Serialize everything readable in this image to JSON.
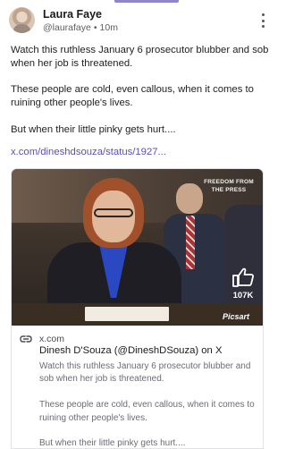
{
  "post": {
    "author_name": "Laura Faye",
    "handle": "@laurafaye",
    "separator": "•",
    "time": "10m",
    "paragraphs": [
      "Watch this ruthless January 6 prosecutor blubber and sob when her job is threatened.",
      "These people are cold, even callous, when it comes to ruining other people's lives.",
      "But when their little pinky gets hurt...."
    ],
    "link_text": "x.com/dineshdsouza/status/1927..."
  },
  "card": {
    "video": {
      "watermark": "FREEDOM FROM THE PRESS",
      "likes": "107K",
      "app_watermark": "Picsart"
    },
    "domain": "x.com",
    "title": "Dinesh D'Souza (@DineshDSouza) on X",
    "description": [
      "Watch this ruthless January 6 prosecutor blubber and sob when her job is threatened.",
      "These people are cold, even callous, when it comes to ruining other people's lives.",
      "But when their little pinky gets hurt...."
    ]
  },
  "icons": {
    "more": "more-vertical-icon",
    "link": "link-icon",
    "like": "thumbs-up-icon"
  },
  "colors": {
    "link": "#5a4fb8",
    "accent": "#8e86c8"
  }
}
